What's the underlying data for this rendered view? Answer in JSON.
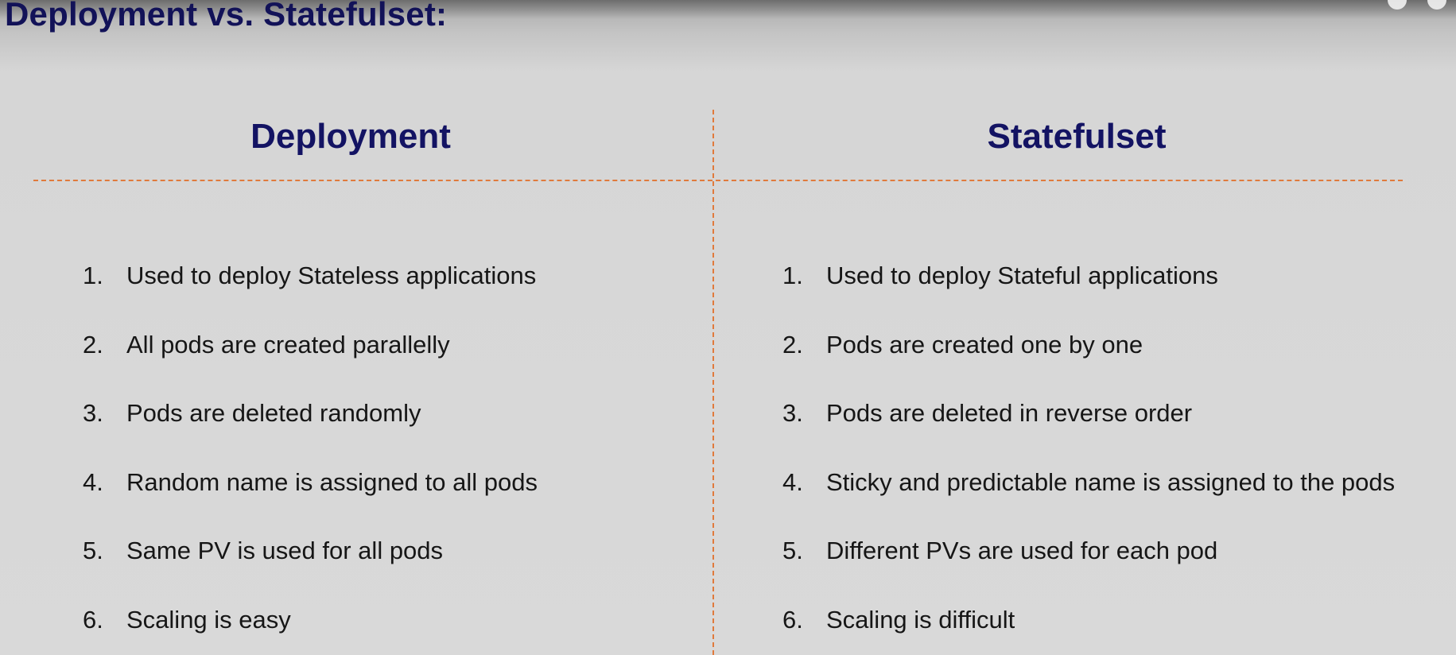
{
  "slide": {
    "title": "Deployment vs. Statefulset:"
  },
  "columns": {
    "left": {
      "heading": "Deployment",
      "items": [
        {
          "num": "1.",
          "text": "Used to deploy Stateless applications"
        },
        {
          "num": "2.",
          "text": "All pods are created parallelly"
        },
        {
          "num": "3.",
          "text": "Pods are deleted randomly"
        },
        {
          "num": "4.",
          "text": "Random name is assigned to all pods"
        },
        {
          "num": "5.",
          "text": "Same PV is used for all pods"
        },
        {
          "num": "6.",
          "text": "Scaling is easy"
        }
      ]
    },
    "right": {
      "heading": "Statefulset",
      "items": [
        {
          "num": "1.",
          "text": "Used to deploy Stateful applications"
        },
        {
          "num": "2.",
          "text": "Pods are created one by one"
        },
        {
          "num": "3.",
          "text": "Pods are deleted in reverse order"
        },
        {
          "num": "4.",
          "text": "Sticky and predictable name is assigned to the pods"
        },
        {
          "num": "5.",
          "text": "Different PVs are used for each pod"
        },
        {
          "num": "6.",
          "text": "Scaling is difficult"
        }
      ]
    }
  },
  "colors": {
    "title": "#121258",
    "heading": "#131363",
    "divider": "#e07a3c",
    "body_text": "#161616",
    "background": "#d9d9d9"
  }
}
